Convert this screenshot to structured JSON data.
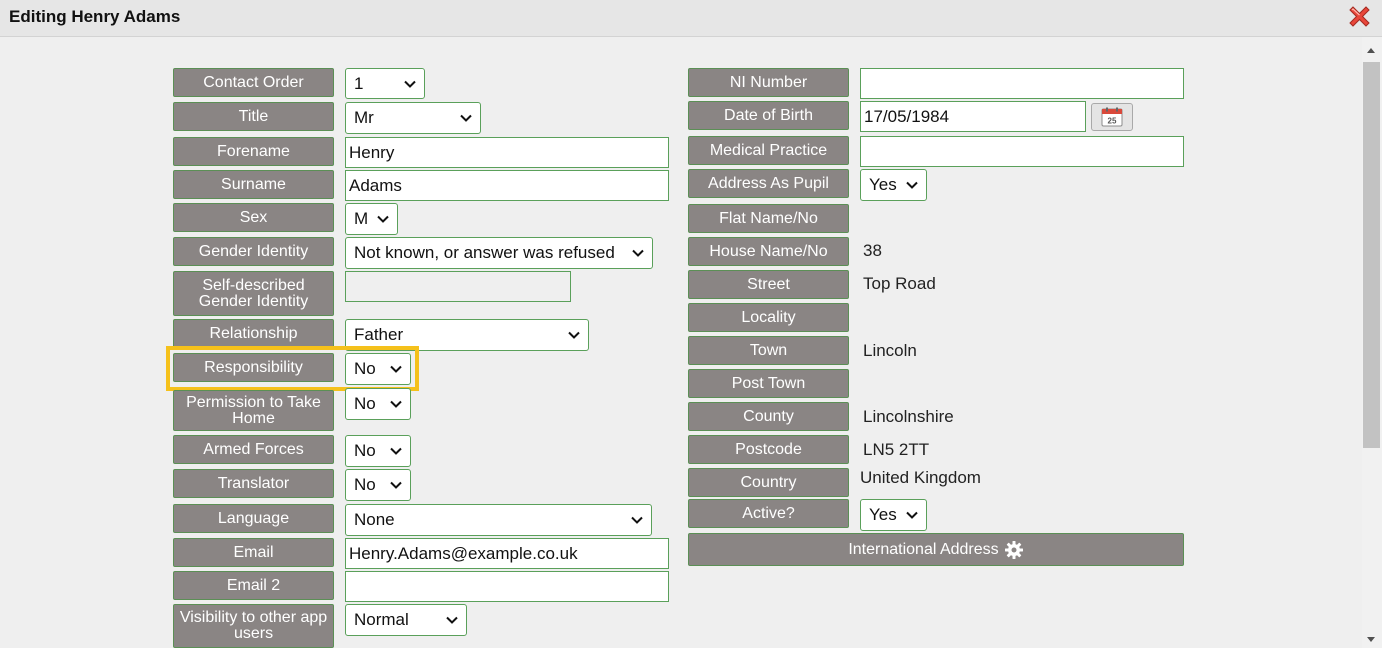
{
  "window": {
    "title": "Editing Henry Adams",
    "close_icon": "close-icon"
  },
  "left": {
    "contact_order": {
      "label": "Contact Order",
      "value": "1"
    },
    "title": {
      "label": "Title",
      "value": "Mr"
    },
    "forename": {
      "label": "Forename",
      "value": "Henry"
    },
    "surname": {
      "label": "Surname",
      "value": "Adams"
    },
    "sex": {
      "label": "Sex",
      "value": "M"
    },
    "gender_identity": {
      "label": "Gender Identity",
      "value": "Not known, or answer was refused"
    },
    "self_described": {
      "label": "Self-described Gender Identity",
      "value": ""
    },
    "relationship": {
      "label": "Relationship",
      "value": "Father"
    },
    "responsibility": {
      "label": "Responsibility",
      "value": "No"
    },
    "permission": {
      "label": "Permission to Take Home",
      "value": "No"
    },
    "armed_forces": {
      "label": "Armed Forces",
      "value": "No"
    },
    "translator": {
      "label": "Translator",
      "value": "No"
    },
    "language": {
      "label": "Language",
      "value": "None"
    },
    "email": {
      "label": "Email",
      "value": "Henry.Adams@example.co.uk"
    },
    "email2": {
      "label": "Email 2",
      "value": ""
    },
    "visibility": {
      "label": "Visibility to other app users",
      "value": "Normal"
    }
  },
  "right": {
    "ni_number": {
      "label": "NI Number",
      "value": ""
    },
    "dob": {
      "label": "Date of Birth",
      "value": "17/05/1984",
      "calendar_day": "25"
    },
    "medical_practice": {
      "label": "Medical Practice",
      "value": ""
    },
    "address_as_pupil": {
      "label": "Address As Pupil",
      "value": "Yes"
    },
    "flat": {
      "label": "Flat Name/No",
      "value": ""
    },
    "house": {
      "label": "House Name/No",
      "value": "38"
    },
    "street": {
      "label": "Street",
      "value": "Top Road"
    },
    "locality": {
      "label": "Locality",
      "value": ""
    },
    "town": {
      "label": "Town",
      "value": "Lincoln"
    },
    "post_town": {
      "label": "Post Town",
      "value": ""
    },
    "county": {
      "label": "County",
      "value": "Lincolnshire"
    },
    "postcode": {
      "label": "Postcode",
      "value": "LN5 2TT"
    },
    "country": {
      "label": "Country",
      "value": "United Kingdom"
    },
    "active": {
      "label": "Active?",
      "value": "Yes"
    },
    "international_address": {
      "label": "International Address",
      "icon": "gear-icon"
    }
  },
  "colors": {
    "label_bg": "#8a8584",
    "border_green": "#5aa05a",
    "highlight": "#f5c11b"
  }
}
